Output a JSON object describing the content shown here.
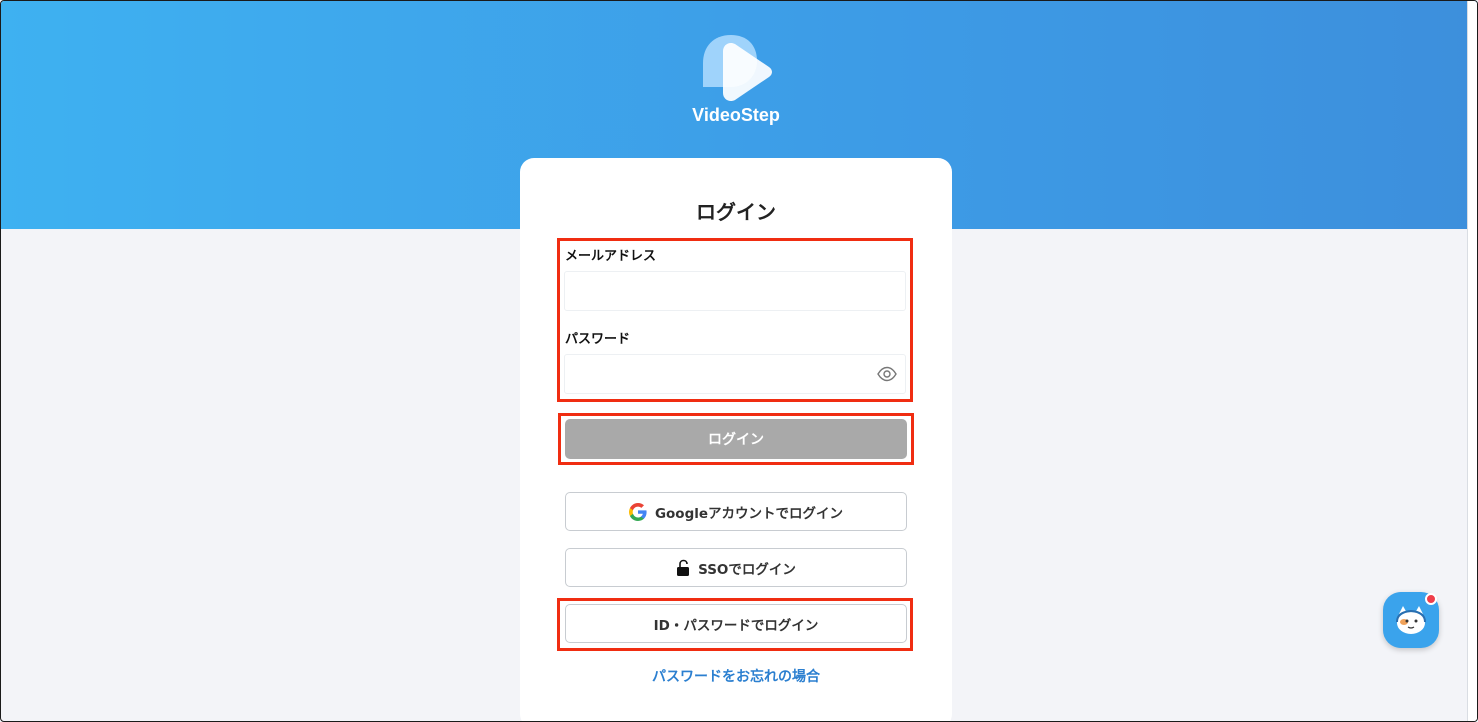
{
  "brand": {
    "name": "VideoStep"
  },
  "login": {
    "title": "ログイン",
    "email_label": "メールアドレス",
    "email_value": "",
    "password_label": "パスワード",
    "password_value": "",
    "submit_label": "ログイン",
    "google_label": "Googleアカウントでログイン",
    "sso_label": "SSOでログイン",
    "id_password_label": "ID・パスワードでログイン",
    "forgot_label": "パスワードをお忘れの場合"
  },
  "colors": {
    "header_gradient_start": "#3eb1f1",
    "header_gradient_end": "#3d8fdc",
    "highlight": "#f02d11",
    "submit_disabled": "#a9a9a9",
    "link": "#2b7fd0"
  },
  "icons": {
    "password_toggle": "eye-icon",
    "google": "google-g-icon",
    "sso": "unlock-icon",
    "chat": "chat-support-icon"
  }
}
